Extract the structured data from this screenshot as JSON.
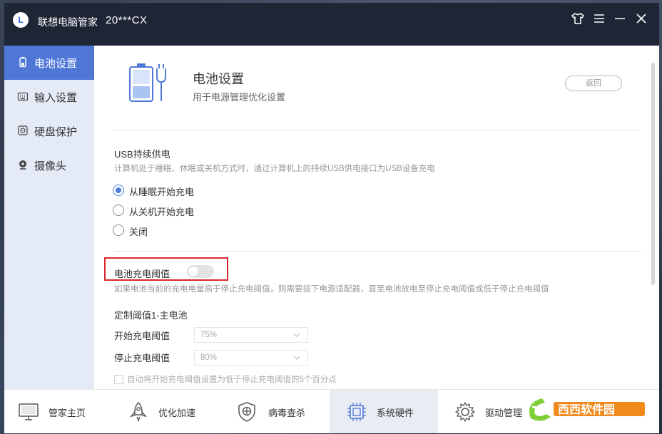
{
  "titlebar": {
    "logo_letter": "L",
    "app_name": "联想电脑管家",
    "user": "20***CX"
  },
  "sidebar": {
    "items": [
      {
        "label": "电池设置",
        "icon": "battery-icon",
        "active": true
      },
      {
        "label": "输入设置",
        "icon": "keyboard-icon",
        "active": false
      },
      {
        "label": "硬盘保护",
        "icon": "disk-icon",
        "active": false
      },
      {
        "label": "摄像头",
        "icon": "camera-icon",
        "active": false
      }
    ]
  },
  "header": {
    "title": "电池设置",
    "subtitle": "用于电源管理优化设置",
    "back_label": "返回"
  },
  "usb": {
    "title": "USB持续供电",
    "desc": "计算机处于睡眠、休眠或关机方式时，通过计算机上的持续USB供电接口为USB设备充电",
    "options": [
      "从睡眠开始充电",
      "从关机开始充电",
      "关闭"
    ],
    "selected": 0
  },
  "threshold": {
    "title": "电池充电阈值",
    "enabled": false,
    "desc": "如果电池当前的充电电量高于停止充电阈值，则需要拔下电源适配器，直至电池放电至停止充电阈值或低于停止充电阈值",
    "sub_title": "定制阈值1-主电池",
    "start_label": "开始充电阈值",
    "start_value": "75%",
    "stop_label": "停止充电阈值",
    "stop_value": "80%",
    "auto_label": "自动将开始充电阈值设置为低于停止充电阈值的5个百分点"
  },
  "bottom_nav": [
    {
      "label": "管家主页",
      "icon": "monitor-icon"
    },
    {
      "label": "优化加速",
      "icon": "rocket-icon"
    },
    {
      "label": "病毒查杀",
      "icon": "shield-icon"
    },
    {
      "label": "系统硬件",
      "icon": "chip-icon",
      "active": true
    },
    {
      "label": "驱动管理",
      "icon": "gear-icon"
    }
  ],
  "watermark": {
    "text": "西西软件园",
    "site": "CR173.COM"
  },
  "colors": {
    "accent": "#4f78d6",
    "titlebar": "#1e2535",
    "sidebar": "#e4ebf6",
    "highlight": "#d6262c"
  }
}
